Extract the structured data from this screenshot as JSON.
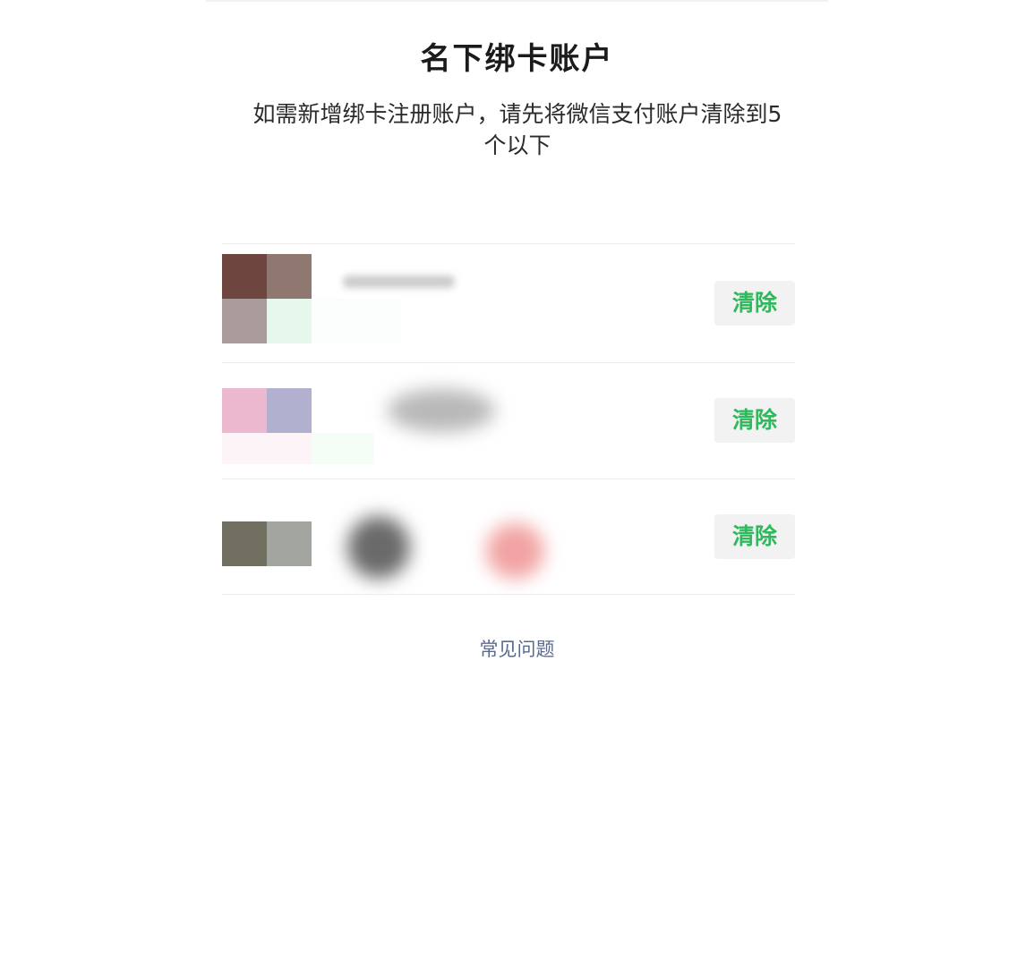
{
  "header": {
    "title": "名下绑卡账户",
    "subtitle_line1": "如需新增绑卡注册账户，请先将微信支付账户清除到5",
    "subtitle_line2": "个以下"
  },
  "accounts": [
    {
      "name": "",
      "clear_label": "清除",
      "avatar_colors": [
        "#6e453f",
        "#8e7870",
        "#aa9c9c",
        "#e6f8ec",
        "#fbfefc"
      ]
    },
    {
      "name": "",
      "clear_label": "清除",
      "avatar_colors": [
        "#ecb8cf",
        "#b1b0cf",
        "#fefffe",
        "#fdf4f8",
        "#f4fef7"
      ]
    },
    {
      "name": "",
      "clear_label": "清除",
      "avatar_colors": [
        "#716f5f",
        "#a2a5a0"
      ]
    }
  ],
  "footer": {
    "faq_label": "常见问题"
  },
  "colors": {
    "accent_green": "#2fb85c",
    "link_blue": "#5b6b8f",
    "button_bg": "#f2f2f2"
  }
}
